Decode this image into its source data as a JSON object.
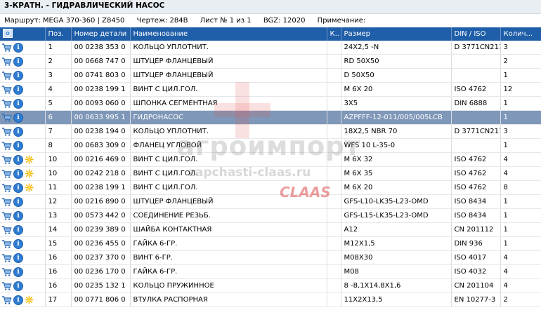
{
  "title": "3-КРАТН. - ГИДРАВЛИЧЕСКИЙ НАСОС",
  "meta": {
    "route": "Маршрут: MEGA 370-360 | Z8450",
    "drawing": "Чертеж: 284B",
    "sheet": "Лист № 1 из 1",
    "bgz": "BGZ: 12020",
    "note": "Примечание:"
  },
  "columns": {
    "pos": "Поз.",
    "part": "Номер детали",
    "name": "Наименование",
    "k": "К..",
    "size": "Размер",
    "din": "DIN / ISO",
    "qty": "Колич..."
  },
  "watermark": {
    "brand": "агроимпорт",
    "site": "zapchasti-claas.ru",
    "logo": "CLAAS"
  },
  "colors": {
    "header": "#1f5ea8",
    "selected_row": "#7f97b8",
    "info_icon": "#2f7dd3",
    "star_icon": "#f0b400"
  },
  "rows": [
    {
      "icons": [
        "cart-icon",
        "info-icon"
      ],
      "pos": "1",
      "part": "00 0238 353 0",
      "name": "КОЛЬЦО УПЛОТНИТ.",
      "k": "",
      "size": "24X2,5 -N",
      "din": "D 3771CN211",
      "qty": "3"
    },
    {
      "icons": [
        "cart-icon",
        "info-icon"
      ],
      "pos": "2",
      "part": "00 0668 747 0",
      "name": "ШТУЦЕР ФЛАНЦЕВЫЙ",
      "k": "",
      "size": "RD 50X50",
      "din": "",
      "qty": "2"
    },
    {
      "icons": [
        "cart-icon",
        "info-icon"
      ],
      "pos": "3",
      "part": "00 0741 803 0",
      "name": "ШТУЦЕР ФЛАНЦЕВЫЙ",
      "k": "",
      "size": "D 50X50",
      "din": "",
      "qty": "1"
    },
    {
      "icons": [
        "cart-icon",
        "info-icon"
      ],
      "pos": "4",
      "part": "00 0238 199 1",
      "name": "ВИНТ С ЦИЛ.ГОЛ.",
      "k": "",
      "size": "M 6X 20",
      "din": "ISO 4762",
      "qty": "12"
    },
    {
      "icons": [
        "cart-icon",
        "info-icon"
      ],
      "pos": "5",
      "part": "00 0093 060 0",
      "name": "ШПОНКА СЕГМЕНТНАЯ",
      "k": "",
      "size": "3X5",
      "din": "DIN 6888",
      "qty": "1"
    },
    {
      "icons": [
        "cart-icon",
        "info-icon"
      ],
      "pos": "6",
      "part": "00 0633 995 1",
      "name": "ГИДРОНАСОС",
      "k": "",
      "size": "AZPFFF-12-011/005/005LCB",
      "din": "",
      "qty": "1",
      "selected": true
    },
    {
      "icons": [
        "cart-icon",
        "info-icon"
      ],
      "pos": "7",
      "part": "00 0238 194 0",
      "name": "КОЛЬЦО УПЛОТНИТ.",
      "k": "",
      "size": "18X2,5 NBR 70",
      "din": "D 3771CN211",
      "qty": "3"
    },
    {
      "icons": [
        "cart-icon",
        "info-icon"
      ],
      "pos": "8",
      "part": "00 0683 309 0",
      "name": "ФЛАНЕЦ УГЛОВОЙ",
      "k": "",
      "size": "WFS 10 L-35-0",
      "din": "",
      "qty": "1"
    },
    {
      "icons": [
        "cart-icon",
        "info-icon",
        "star-icon"
      ],
      "pos": "10",
      "part": "00 0216 469 0",
      "name": "ВИНТ С ЦИЛ.ГОЛ.",
      "k": "",
      "size": "M 6X 32",
      "din": "ISO 4762",
      "qty": "4"
    },
    {
      "icons": [
        "cart-icon",
        "info-icon",
        "star-icon"
      ],
      "pos": "10",
      "part": "00 0242 218 0",
      "name": "ВИНТ С ЦИЛ.ГОЛ.",
      "k": "",
      "size": "M 6X 35",
      "din": "ISO 4762",
      "qty": "4"
    },
    {
      "icons": [
        "cart-icon",
        "info-icon",
        "star-icon"
      ],
      "pos": "11",
      "part": "00 0238 199 1",
      "name": "ВИНТ С ЦИЛ.ГОЛ.",
      "k": "",
      "size": "M 6X 20",
      "din": "ISO 4762",
      "qty": "8"
    },
    {
      "icons": [
        "cart-icon",
        "info-icon"
      ],
      "pos": "12",
      "part": "00 0216 890 0",
      "name": "ШТУЦЕР ФЛАНЦЕВЫЙ",
      "k": "",
      "size": "GFS-L10-LK35-L23-OMD",
      "din": "ISO 8434",
      "qty": "1"
    },
    {
      "icons": [
        "cart-icon",
        "info-icon"
      ],
      "pos": "13",
      "part": "00 0573 442 0",
      "name": "СОЕДИНЕНИЕ РЕЗЬБ.",
      "k": "",
      "size": "GFS-L15-LK35-L23-OMD",
      "din": "ISO 8434",
      "qty": "1"
    },
    {
      "icons": [
        "cart-icon",
        "info-icon"
      ],
      "pos": "14",
      "part": "00 0239 389 0",
      "name": "ШАЙБА КОНТАКТНАЯ",
      "k": "",
      "size": "A12",
      "din": "CN 201112",
      "qty": "1"
    },
    {
      "icons": [
        "cart-icon",
        "info-icon"
      ],
      "pos": "15",
      "part": "00 0236 455 0",
      "name": "ГАЙКА 6-ГР.",
      "k": "",
      "size": "M12X1,5",
      "din": "DIN 936",
      "qty": "1"
    },
    {
      "icons": [
        "cart-icon",
        "info-icon"
      ],
      "pos": "16",
      "part": "00 0237 370 0",
      "name": "ВИНТ 6-ГР.",
      "k": "",
      "size": "M08X30",
      "din": "ISO 4017",
      "qty": "4"
    },
    {
      "icons": [
        "cart-icon",
        "info-icon"
      ],
      "pos": "16",
      "part": "00 0236 170 0",
      "name": "ГАЙКА 6-ГР.",
      "k": "",
      "size": "M08",
      "din": "ISO 4032",
      "qty": "4"
    },
    {
      "icons": [
        "cart-icon",
        "info-icon"
      ],
      "pos": "16",
      "part": "00 0235 132 1",
      "name": "КОЛЬЦО ПРУЖИННОЕ",
      "k": "",
      "size": "8 -8,1X14,8X1,6",
      "din": "CN 201104",
      "qty": "4"
    },
    {
      "icons": [
        "cart-icon",
        "info-icon",
        "star-icon"
      ],
      "pos": "17",
      "part": "00 0771 806 0",
      "name": "ВТУЛКА РАСПОРНАЯ",
      "k": "",
      "size": "11X2X13,5",
      "din": "EN 10277-3",
      "qty": "2"
    }
  ]
}
